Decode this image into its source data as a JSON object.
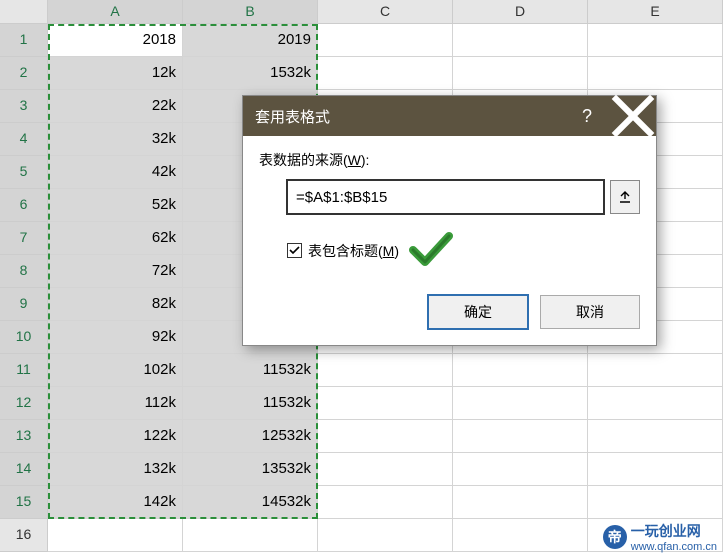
{
  "columns": [
    "A",
    "B",
    "C",
    "D",
    "E"
  ],
  "rows": [
    {
      "n": "1",
      "a": "2018",
      "b": "2019"
    },
    {
      "n": "2",
      "a": "12k",
      "b": "1532k"
    },
    {
      "n": "3",
      "a": "22k",
      "b": ""
    },
    {
      "n": "4",
      "a": "32k",
      "b": ""
    },
    {
      "n": "5",
      "a": "42k",
      "b": ""
    },
    {
      "n": "6",
      "a": "52k",
      "b": ""
    },
    {
      "n": "7",
      "a": "62k",
      "b": ""
    },
    {
      "n": "8",
      "a": "72k",
      "b": ""
    },
    {
      "n": "9",
      "a": "82k",
      "b": ""
    },
    {
      "n": "10",
      "a": "92k",
      "b": ""
    },
    {
      "n": "11",
      "a": "102k",
      "b": "11532k"
    },
    {
      "n": "12",
      "a": "112k",
      "b": "11532k"
    },
    {
      "n": "13",
      "a": "122k",
      "b": "12532k"
    },
    {
      "n": "14",
      "a": "132k",
      "b": "13532k"
    },
    {
      "n": "15",
      "a": "142k",
      "b": "14532k"
    },
    {
      "n": "16",
      "a": "",
      "b": ""
    }
  ],
  "dialog": {
    "title": "套用表格式",
    "source_label_pre": "表数据的来源(",
    "source_label_key": "W",
    "source_label_post": "):",
    "range_value": "=$A$1:$B$15",
    "header_check_pre": "表包含标题(",
    "header_check_key": "M",
    "header_check_post": ")",
    "header_checked": true,
    "ok": "确定",
    "cancel": "取消"
  },
  "watermark": {
    "text": "一玩创业网",
    "url": "www.qfan.com.cn"
  }
}
